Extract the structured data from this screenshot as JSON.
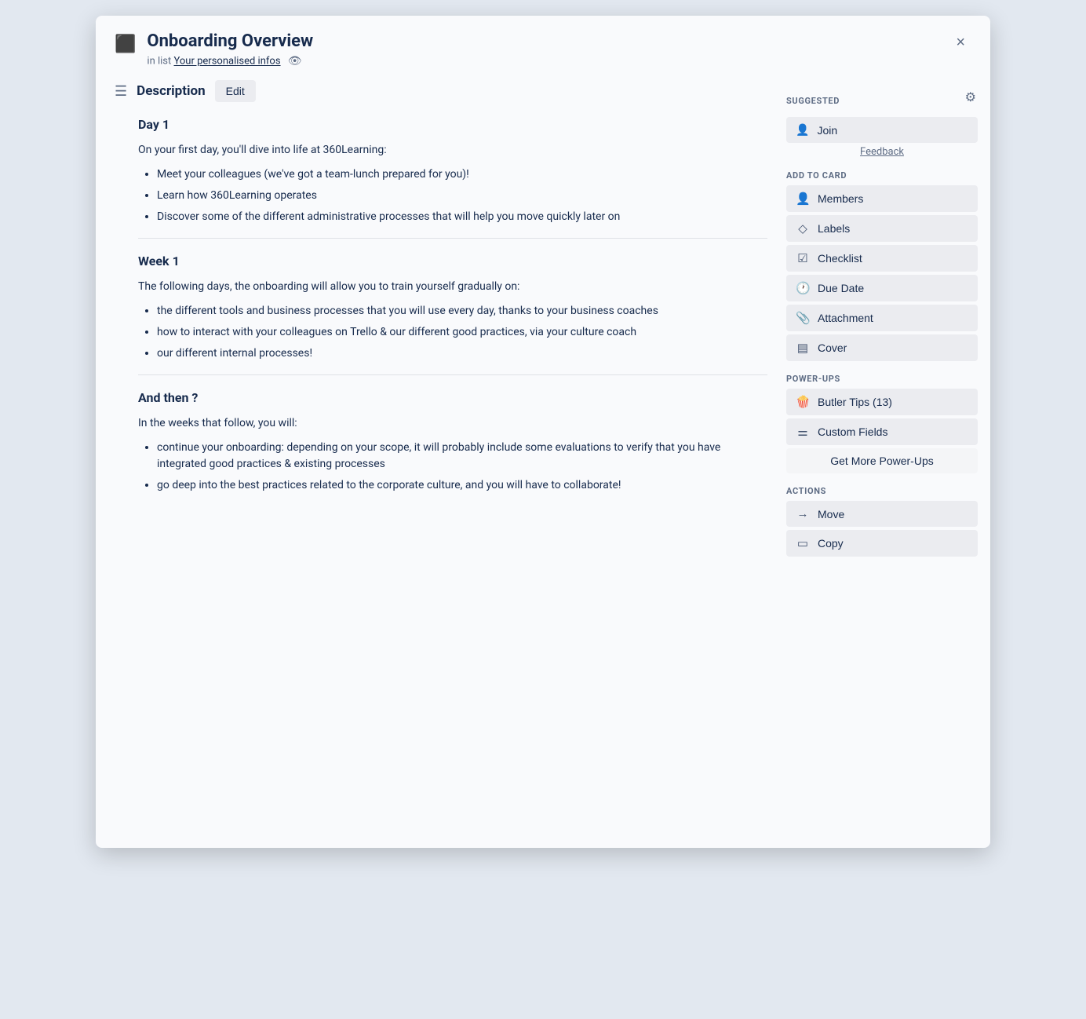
{
  "modal": {
    "card_title": "Onboarding Overview",
    "card_subtitle_prefix": "in list",
    "card_list_link": "Your personalised infos",
    "close_label": "×"
  },
  "description": {
    "section_label": "Description",
    "edit_button": "Edit"
  },
  "sections": [
    {
      "heading": "Day 1",
      "intro": "On your first day, you'll dive into life at 360Learning:",
      "bullets": [
        "Meet your colleagues (we've got a team-lunch prepared for you)!",
        "Learn how 360Learning operates",
        "Discover some of the different administrative processes that will help you move quickly later on"
      ]
    },
    {
      "heading": "Week 1",
      "intro": "The following days, the onboarding will allow you to train yourself gradually on:",
      "bullets": [
        "the different tools and business processes that you will use every day, thanks to your business coaches",
        "how to interact with your colleagues on Trello & our different good practices, via your culture coach",
        "our different internal processes!"
      ]
    },
    {
      "heading": "And then ?",
      "intro": "In the weeks that follow, you will:",
      "bullets": [
        "continue your onboarding: depending on your scope, it will probably include some evaluations to verify that you have integrated good practices & existing processes",
        "go deep into the best practices related to the corporate culture, and you will have to collaborate!"
      ]
    }
  ],
  "sidebar": {
    "suggested_label": "SUGGESTED",
    "join_label": "Join",
    "feedback_label": "Feedback",
    "add_to_card_label": "ADD TO CARD",
    "members_label": "Members",
    "labels_label": "Labels",
    "checklist_label": "Checklist",
    "due_date_label": "Due Date",
    "attachment_label": "Attachment",
    "cover_label": "Cover",
    "power_ups_label": "POWER-UPS",
    "butler_tips_label": "Butler Tips (13)",
    "custom_fields_label": "Custom Fields",
    "get_more_label": "Get More Power-Ups",
    "actions_label": "ACTIONS",
    "move_label": "Move",
    "copy_label": "Copy"
  }
}
